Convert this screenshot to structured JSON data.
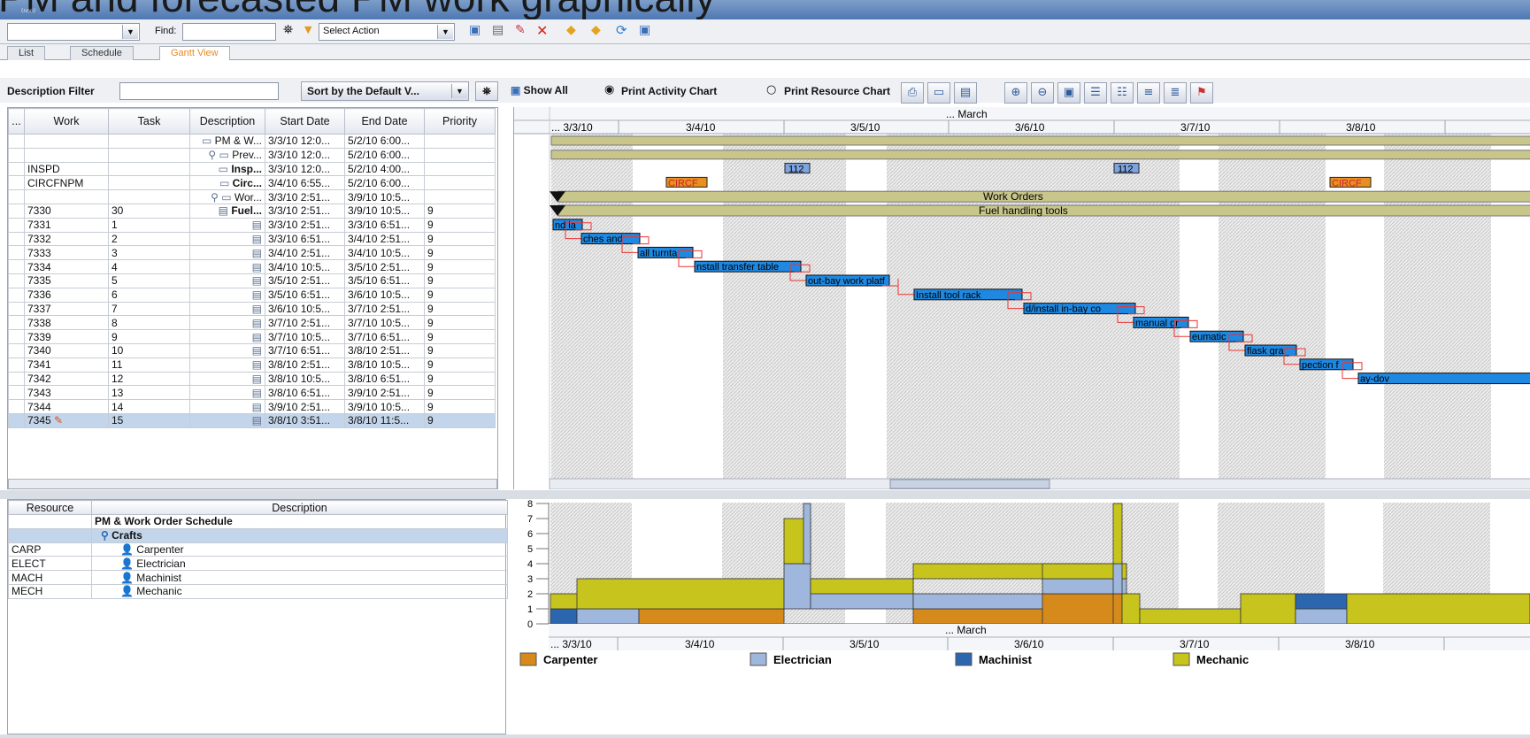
{
  "slide_title": "PM and forecasted PM work graphically",
  "window_caption": "(nnn)",
  "toolbar": {
    "find_label": "Find:",
    "action_select": "Select Action"
  },
  "tabs": [
    "List",
    "Schedule",
    "Gantt View"
  ],
  "filter": {
    "label": "Description Filter",
    "sort_label": "Sort by the Default V...",
    "show_all": "Show All",
    "print_activity": "Print Activity Chart",
    "print_resource": "Print Resource Chart"
  },
  "columns": [
    "...",
    "Work",
    "Task",
    "Description",
    "Start Date",
    "End Date",
    "Priority"
  ],
  "rows": [
    [
      "",
      "",
      "",
      "PM & W...",
      "3/3/10 12:0...",
      "5/2/10 6:00...",
      ""
    ],
    [
      "",
      "",
      "",
      "Prev...",
      "3/3/10 12:0...",
      "5/2/10 6:00...",
      ""
    ],
    [
      "",
      "INSPD",
      "",
      "Insp...",
      "3/3/10 12:0...",
      "5/2/10 4:00...",
      ""
    ],
    [
      "",
      "CIRCFNPM",
      "",
      "Circ...",
      "3/4/10 6:55...",
      "5/2/10 6:00...",
      ""
    ],
    [
      "",
      "",
      "",
      "Wor...",
      "3/3/10 2:51...",
      "3/9/10 10:5...",
      ""
    ],
    [
      "",
      "7330",
      "30",
      "Fuel...",
      "3/3/10 2:51...",
      "3/9/10 10:5...",
      "9"
    ],
    [
      "",
      "7331",
      "1",
      "",
      "3/3/10 2:51...",
      "3/3/10 6:51...",
      "9"
    ],
    [
      "",
      "7332",
      "2",
      "",
      "3/3/10 6:51...",
      "3/4/10 2:51...",
      "9"
    ],
    [
      "",
      "7333",
      "3",
      "",
      "3/4/10 2:51...",
      "3/4/10 10:5...",
      "9"
    ],
    [
      "",
      "7334",
      "4",
      "",
      "3/4/10 10:5...",
      "3/5/10 2:51...",
      "9"
    ],
    [
      "",
      "7335",
      "5",
      "",
      "3/5/10 2:51...",
      "3/5/10 6:51...",
      "9"
    ],
    [
      "",
      "7336",
      "6",
      "",
      "3/5/10 6:51...",
      "3/6/10 10:5...",
      "9"
    ],
    [
      "",
      "7337",
      "7",
      "",
      "3/6/10 10:5...",
      "3/7/10 2:51...",
      "9"
    ],
    [
      "",
      "7338",
      "8",
      "",
      "3/7/10 2:51...",
      "3/7/10 10:5...",
      "9"
    ],
    [
      "",
      "7339",
      "9",
      "",
      "3/7/10 10:5...",
      "3/7/10 6:51...",
      "9"
    ],
    [
      "",
      "7340",
      "10",
      "",
      "3/7/10 6:51...",
      "3/8/10 2:51...",
      "9"
    ],
    [
      "",
      "7341",
      "11",
      "",
      "3/8/10 2:51...",
      "3/8/10 10:5...",
      "9"
    ],
    [
      "",
      "7342",
      "12",
      "",
      "3/8/10 10:5...",
      "3/8/10 6:51...",
      "9"
    ],
    [
      "",
      "7343",
      "13",
      "",
      "3/8/10 6:51...",
      "3/9/10 2:51...",
      "9"
    ],
    [
      "",
      "7344",
      "14",
      "",
      "3/9/10 2:51...",
      "3/9/10 10:5...",
      "9"
    ],
    [
      "",
      "7345",
      "15",
      "",
      "3/8/10 3:51...",
      "3/8/10 11:5...",
      "9"
    ]
  ],
  "gantt": {
    "month": "... March",
    "dates": [
      "... 3/3/10",
      "3/4/10",
      "3/5/10",
      "3/6/10",
      "3/7/10",
      "3/8/10"
    ],
    "labels": {
      "work_orders": "Work Orders",
      "fuel_tools": "Fuel handling tools",
      "insp_a": "112",
      "insp_b": "112",
      "circ_a": "CIRCF",
      "circ_b": "CIRCF"
    },
    "tasks": [
      "nd la",
      "ches and",
      "all turnta",
      "nstall transfer table",
      "out-bay work platf",
      "Install tool rack",
      "d/install in-bay co",
      "manual gr",
      "eumatic",
      "flask gra",
      "pection f",
      "ay-dov"
    ]
  },
  "resources": {
    "columns": [
      "Resource",
      "Description"
    ],
    "rows": [
      [
        "",
        "PM & Work Order Schedule"
      ],
      [
        "",
        "Crafts"
      ],
      [
        "CARP",
        "Carpenter"
      ],
      [
        "ELECT",
        "Electrician"
      ],
      [
        "MACH",
        "Machinist"
      ],
      [
        "MECH",
        "Mechanic"
      ]
    ]
  },
  "histogram": {
    "y_ticks": [
      "8",
      "7",
      "6",
      "5",
      "4",
      "3",
      "2",
      "1",
      "0"
    ],
    "month": "... March",
    "dates": [
      "... 3/3/10",
      "3/4/10",
      "3/5/10",
      "3/6/10",
      "3/7/10",
      "3/8/10"
    ]
  },
  "legend": [
    "Carpenter",
    "Electrician",
    "Machinist",
    "Mechanic"
  ],
  "colors": {
    "carpenter": "#d78a1c",
    "electrician": "#9fb7dc",
    "machinist": "#2c66ae",
    "mechanic": "#c8c41e",
    "task_bar": "#1f88e0",
    "summary_bar": "#c8c68a"
  }
}
